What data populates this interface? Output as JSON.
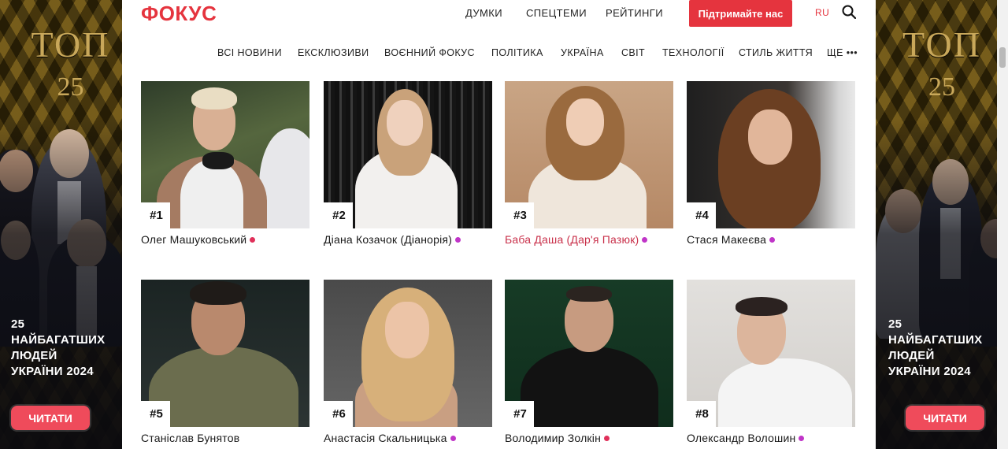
{
  "header": {
    "logo": "ФОКУС",
    "top_links": [
      {
        "label": "ДУМКИ",
        "x": 0
      },
      {
        "label": "СПЕЦТЕМИ",
        "x": 0
      },
      {
        "label": "РЕЙТИНГИ",
        "x": 0
      }
    ],
    "support_label": "Підтримайте нас",
    "lang": "RU",
    "menu": [
      "ВСІ НОВИНИ",
      "ЕКСКЛЮЗИВИ",
      "ВОЄННИЙ ФОКУС",
      "ПОЛІТИКА",
      "УКРАЇНА",
      "СВІТ",
      "ТЕХНОЛОГІЇ",
      "СТИЛЬ ЖИТТЯ",
      "ЩЕ •••"
    ]
  },
  "banner": {
    "title": "ТОП",
    "number": "25",
    "text_lines": [
      "25",
      "НАЙБАГАТШИХ",
      "ЛЮДЕЙ",
      "УКРАЇНИ 2024"
    ],
    "button": "ЧИТАТИ"
  },
  "cards": [
    {
      "rank": "#1",
      "name": "Олег Машуковський",
      "dot": "#e0305a",
      "highlight": false
    },
    {
      "rank": "#2",
      "name": "Діана Козачок (Діанорія)",
      "dot": "#c035c8",
      "highlight": false
    },
    {
      "rank": "#3",
      "name": "Баба Даша (Дар'я Пазюк)",
      "dot": "#c035c8",
      "highlight": true
    },
    {
      "rank": "#4",
      "name": "Стася Макеєва",
      "dot": "#c035c8",
      "highlight": false
    },
    {
      "rank": "#5",
      "name": "Станіслав Бунятов",
      "dot": "",
      "highlight": false
    },
    {
      "rank": "#6",
      "name": "Анастасія Скальницька",
      "dot": "#c035c8",
      "highlight": false
    },
    {
      "rank": "#7",
      "name": "Володимир Золкін",
      "dot": "#e0305a",
      "highlight": false
    },
    {
      "rank": "#8",
      "name": "Олександр Волошин",
      "dot": "#c035c8",
      "highlight": false
    }
  ]
}
